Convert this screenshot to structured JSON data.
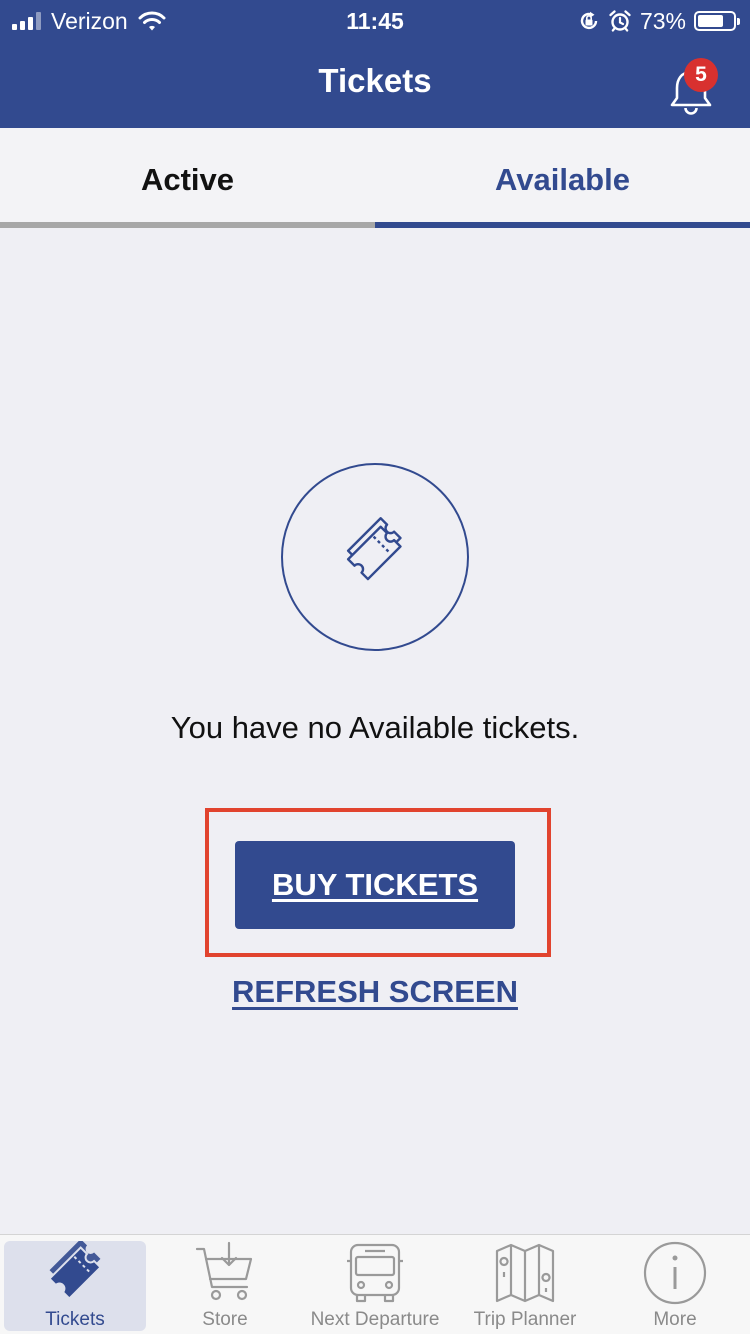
{
  "status_bar": {
    "carrier": "Verizon",
    "time": "11:45",
    "battery_percent": "73%",
    "battery_level": 0.73,
    "icons": [
      "signal-icon",
      "wifi-icon",
      "orientation-lock-icon",
      "alarm-icon",
      "battery-icon"
    ]
  },
  "header": {
    "title": "Tickets",
    "notification_count": "5"
  },
  "tabs": [
    {
      "label": "Active",
      "selected": false
    },
    {
      "label": "Available",
      "selected": true
    }
  ],
  "empty_state": {
    "icon": "ticket-icon",
    "message": "You have no Available tickets.",
    "buy_label": "BUY TICKETS",
    "refresh_label": "REFRESH SCREEN"
  },
  "tab_bar": {
    "items": [
      {
        "label": "Tickets",
        "icon": "tickets-icon",
        "selected": true
      },
      {
        "label": "Store",
        "icon": "cart-icon",
        "selected": false
      },
      {
        "label": "Next Departure",
        "icon": "bus-icon",
        "selected": false
      },
      {
        "label": "Trip Planner",
        "icon": "map-icon",
        "selected": false
      },
      {
        "label": "More",
        "icon": "info-icon",
        "selected": false
      }
    ]
  },
  "colors": {
    "brand": "#324a8f",
    "badge": "#d8312f",
    "highlight": "#e1432e",
    "background": "#efeff4"
  }
}
